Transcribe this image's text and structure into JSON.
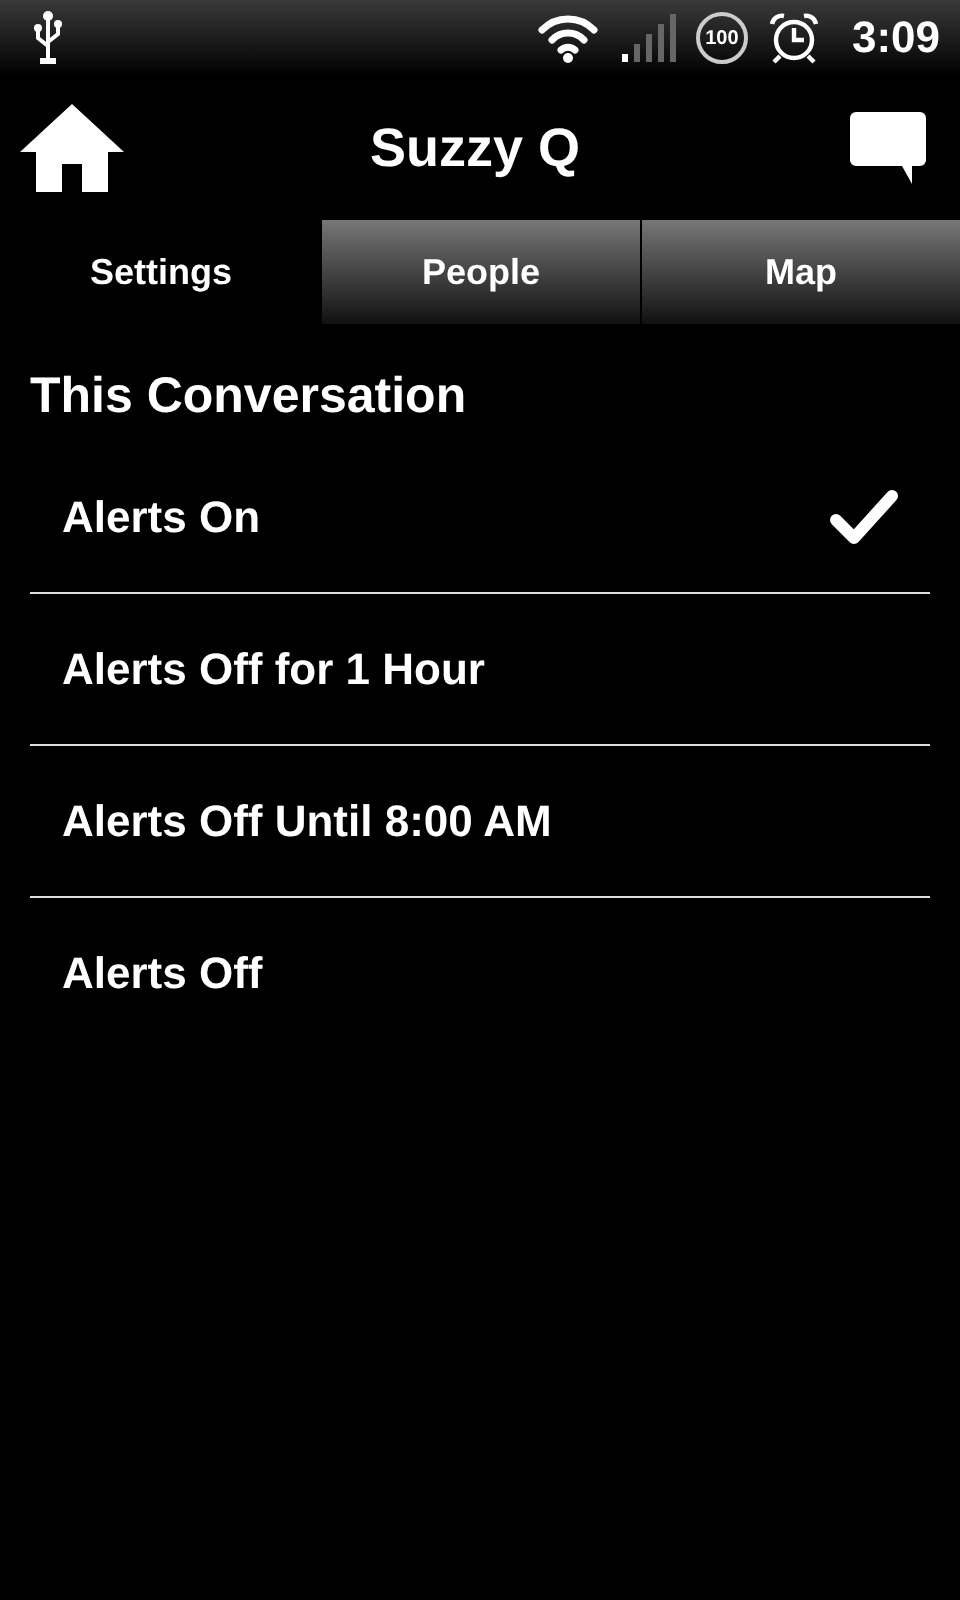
{
  "status_bar": {
    "battery": "100",
    "time": "3:09"
  },
  "header": {
    "title": "Suzzy Q"
  },
  "tabs": [
    {
      "label": "Settings",
      "selected": true
    },
    {
      "label": "People",
      "selected": false
    },
    {
      "label": "Map",
      "selected": false
    }
  ],
  "section": {
    "title": "This Conversation"
  },
  "options": [
    {
      "label": "Alerts On",
      "selected": true
    },
    {
      "label": "Alerts Off for 1 Hour",
      "selected": false
    },
    {
      "label": "Alerts Off Until 8:00 AM",
      "selected": false
    },
    {
      "label": "Alerts Off",
      "selected": false
    }
  ]
}
